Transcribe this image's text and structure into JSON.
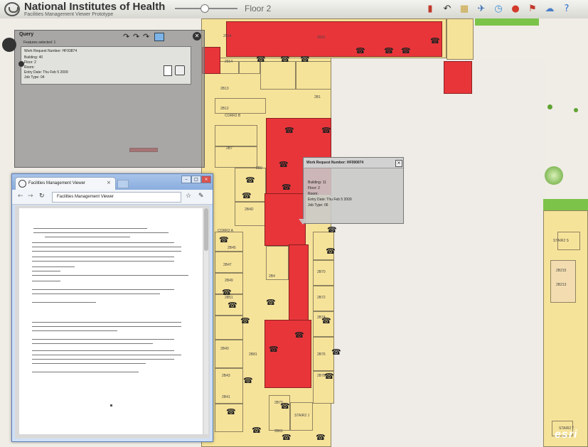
{
  "header": {
    "title": "National Institutes of Health",
    "subtitle": "Facilities Management Viewer Prototype",
    "floor_label": "Floor 2",
    "tools": [
      {
        "icon": "layers-icon",
        "glyph": "▮",
        "color": "#c0392b"
      },
      {
        "icon": "back-icon",
        "glyph": "↶",
        "color": "#333333"
      },
      {
        "icon": "legend-icon",
        "glyph": "▦",
        "color": "#c8a23a"
      },
      {
        "icon": "measure-icon",
        "glyph": "✈",
        "color": "#3a6fb5"
      },
      {
        "icon": "time-icon",
        "glyph": "◷",
        "color": "#3a8fd5"
      },
      {
        "icon": "work-order-icon",
        "glyph": "●",
        "color": "#d23b2b"
      },
      {
        "icon": "flag-icon",
        "glyph": "⚑",
        "color": "#c0392b"
      },
      {
        "icon": "cloud-icon",
        "glyph": "☁",
        "color": "#4a7fc8"
      },
      {
        "icon": "help-icon",
        "glyph": "?",
        "color": "#2a6fcf"
      }
    ]
  },
  "query_panel": {
    "title": "Query",
    "features_selected": "Features selected: 1",
    "work_request": "Work Request Number: HF93874",
    "lines": [
      "Building: 40",
      "Floor: 2",
      "Room:",
      "Entry Date: Thu Feb 5 2009",
      "Job Type: 04"
    ]
  },
  "popup": {
    "title": "Work Request Number: HF090074",
    "lines": [
      "Building: 11",
      "Floor: 2",
      "Room:",
      "Entry Date: Thu Feb 5 2009",
      "Job Type: 06"
    ]
  },
  "browser": {
    "tab_label": "Facilities Management Viewer",
    "url": "Facilities Management Viewer"
  },
  "map": {
    "room_labels": [
      "2914",
      "2913",
      "2914",
      "2B13",
      "2B12",
      "2B1",
      "CORR2 B",
      "2B7",
      "2B9",
      "2B4D",
      "CORR2 A",
      "2B45",
      "2B47",
      "2B49",
      "2B51",
      "2B70",
      "2B72",
      "2B4",
      "2B74",
      "2B76",
      "2B78",
      "2B40",
      "2B43",
      "2B41",
      "2B73",
      "STAIR2 J",
      "STAIR2 S",
      "2B61",
      "STAIR2 T",
      "2B215",
      "2B213",
      "2B81"
    ]
  },
  "watermark": "esri",
  "colors": {
    "room_yellow": "#f6e39a",
    "room_red": "#e8353a",
    "vegetation_green": "#7cc34a"
  }
}
